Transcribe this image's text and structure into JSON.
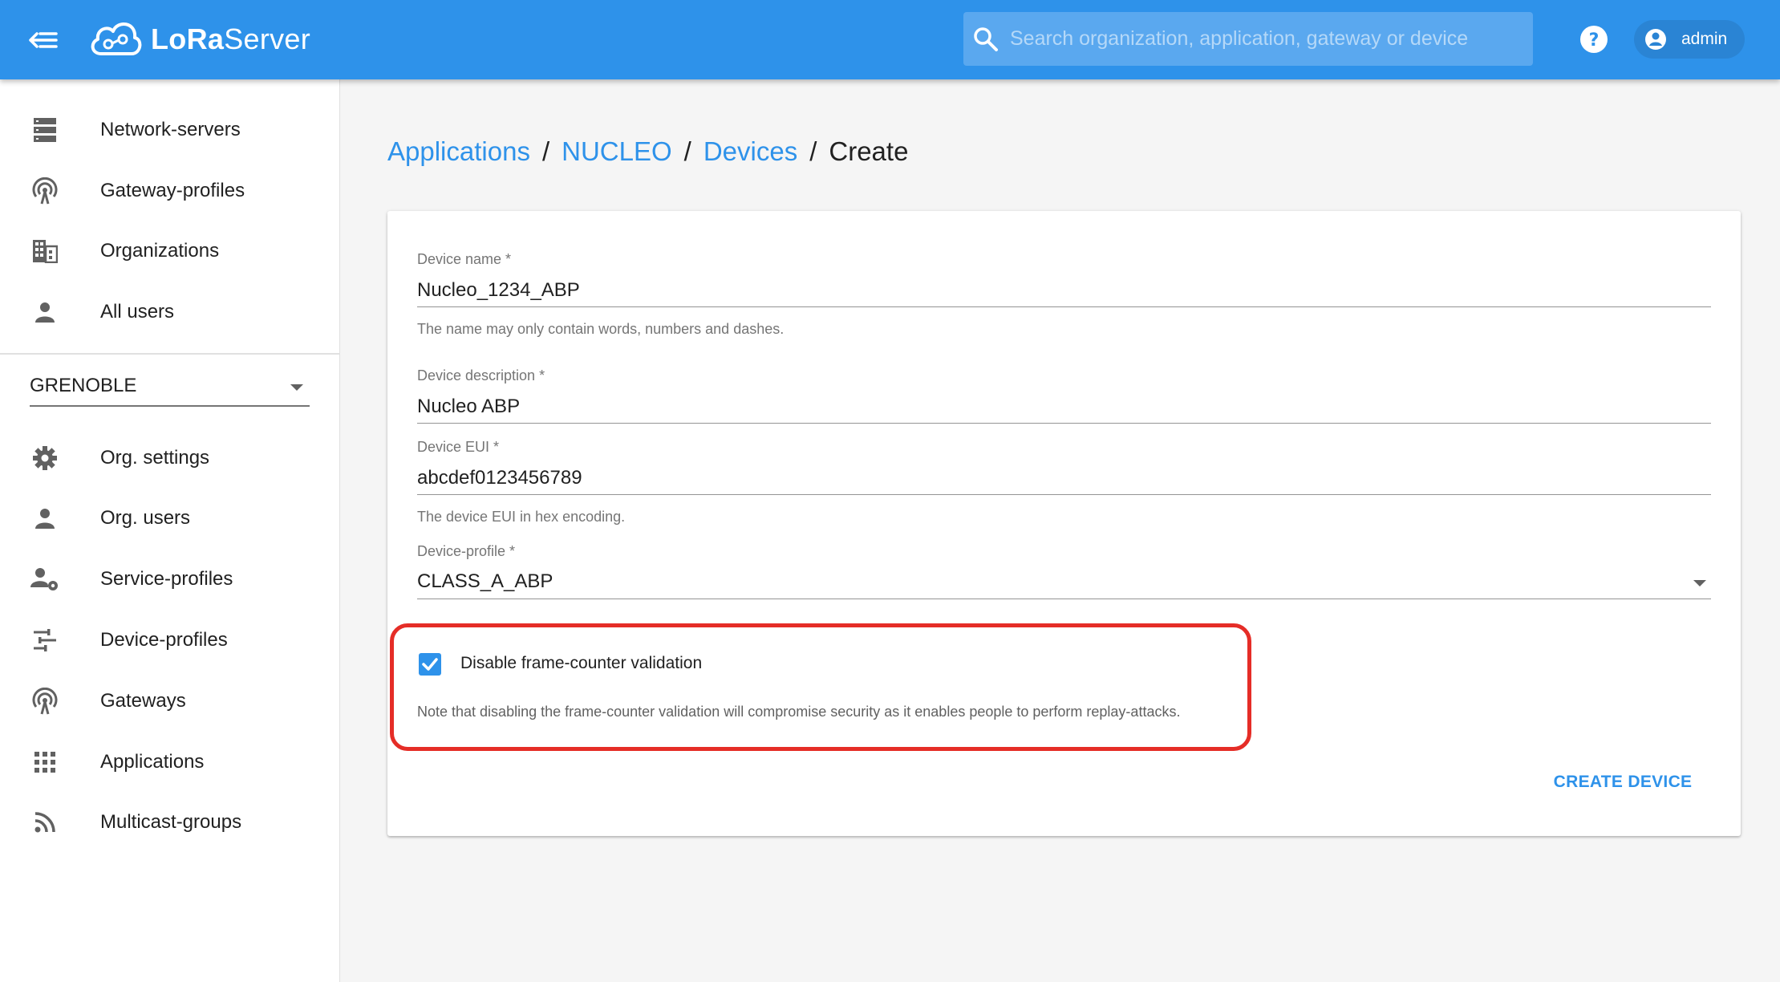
{
  "app": {
    "brand_prefix": "LoRa",
    "brand_suffix": "Server"
  },
  "header": {
    "search_placeholder": "Search organization, application, gateway or device",
    "username": "admin"
  },
  "sidebar": {
    "admin_items": [
      {
        "label": "Network-servers",
        "icon": "server-icon"
      },
      {
        "label": "Gateway-profiles",
        "icon": "antenna-icon"
      },
      {
        "label": "Organizations",
        "icon": "building-icon"
      },
      {
        "label": "All users",
        "icon": "person-icon"
      }
    ],
    "org_selector": {
      "value": "GRENOBLE"
    },
    "org_items": [
      {
        "label": "Org. settings",
        "icon": "gear-icon"
      },
      {
        "label": "Org. users",
        "icon": "person-icon"
      },
      {
        "label": "Service-profiles",
        "icon": "account-settings-icon"
      },
      {
        "label": "Device-profiles",
        "icon": "tune-icon"
      },
      {
        "label": "Gateways",
        "icon": "antenna-icon"
      },
      {
        "label": "Applications",
        "icon": "apps-grid-icon"
      },
      {
        "label": "Multicast-groups",
        "icon": "rss-icon"
      }
    ]
  },
  "breadcrumb": {
    "items": [
      "Applications",
      "NUCLEO",
      "Devices"
    ],
    "separator": "/",
    "current": "Create"
  },
  "form": {
    "device_name": {
      "label": "Device name *",
      "value": "Nucleo_1234_ABP",
      "help": "The name may only contain words, numbers and dashes."
    },
    "device_description": {
      "label": "Device description *",
      "value": "Nucleo ABP"
    },
    "device_eui": {
      "label": "Device EUI *",
      "value": "abcdef0123456789",
      "help": "The device EUI in hex encoding."
    },
    "device_profile": {
      "label": "Device-profile *",
      "value": "CLASS_A_ABP"
    },
    "fcnt_checkbox": {
      "label": "Disable frame-counter validation",
      "checked": true,
      "help": "Note that disabling the frame-counter validation will compromise security as it enables people to perform replay-attacks."
    },
    "submit_label": "CREATE DEVICE"
  },
  "colors": {
    "primary": "#2e92ea",
    "highlight": "#e52d27"
  }
}
